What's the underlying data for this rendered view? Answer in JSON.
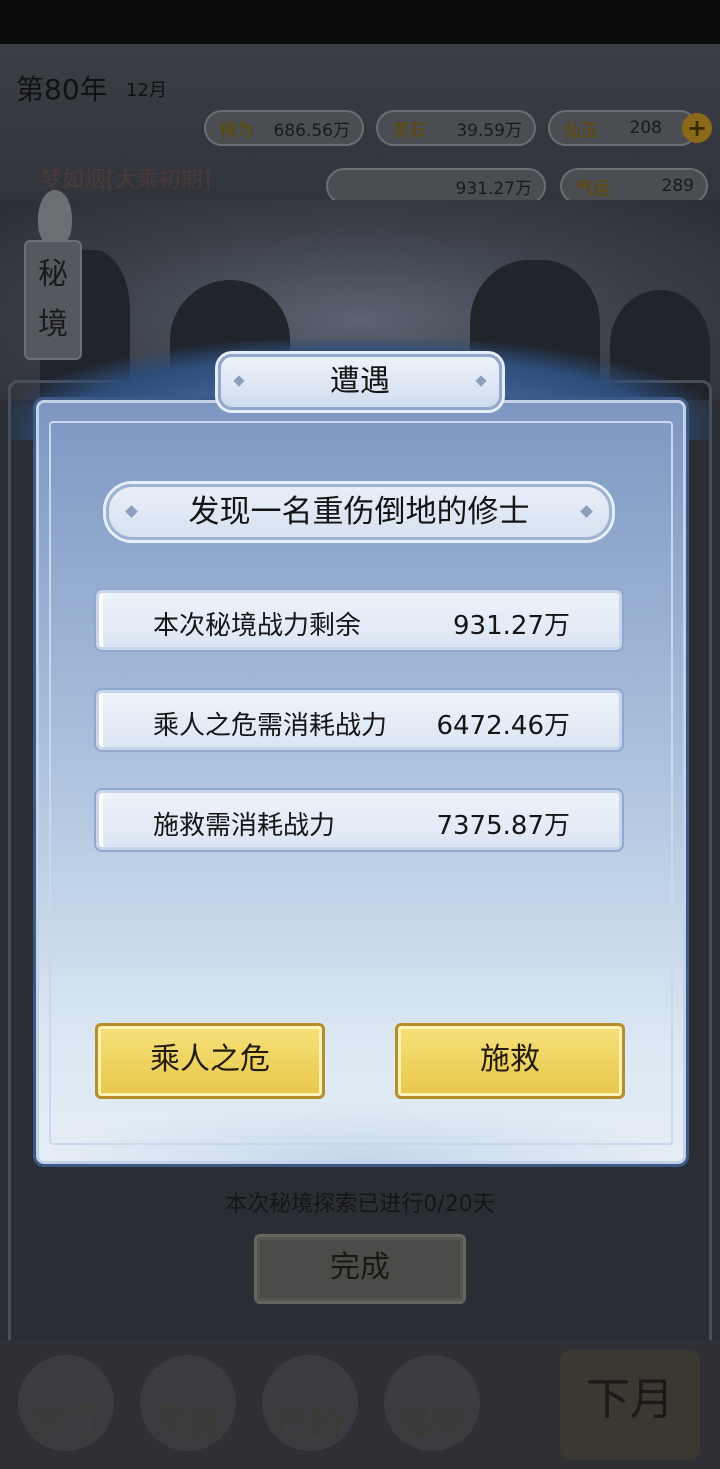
{
  "hud": {
    "year": "第80年",
    "month": "12月",
    "xiuwei_label": "修为",
    "xiuwei_value": "686.56万",
    "lingshi_label": "灵石",
    "lingshi_value": "39.59万",
    "xianyu_label": "仙玉",
    "xianyu_value": "208",
    "character_name": "梦如烟[大乘初期]",
    "power_value": "931.27万",
    "qiyun_label": "气运",
    "qiyun_value": "289"
  },
  "side_tab": {
    "label": "秘\n境"
  },
  "dialog": {
    "title": "遭遇",
    "event": "发现一名重伤倒地的修士",
    "stats": [
      {
        "label": "本次秘境战力剩余",
        "value": "931.27万"
      },
      {
        "label": "乘人之危需消耗战力",
        "value": "6472.46万"
      },
      {
        "label": "施救需消耗战力",
        "value": "7375.87万"
      }
    ],
    "buttons": {
      "exploit": "乘人之危",
      "rescue": "施救"
    }
  },
  "footer": {
    "progress": "本次秘境探索已进行0/20天",
    "done_button": "完成"
  },
  "menu": {
    "items": [
      "宗门",
      "灵器",
      "丹药",
      "储物"
    ],
    "next": "下月"
  }
}
